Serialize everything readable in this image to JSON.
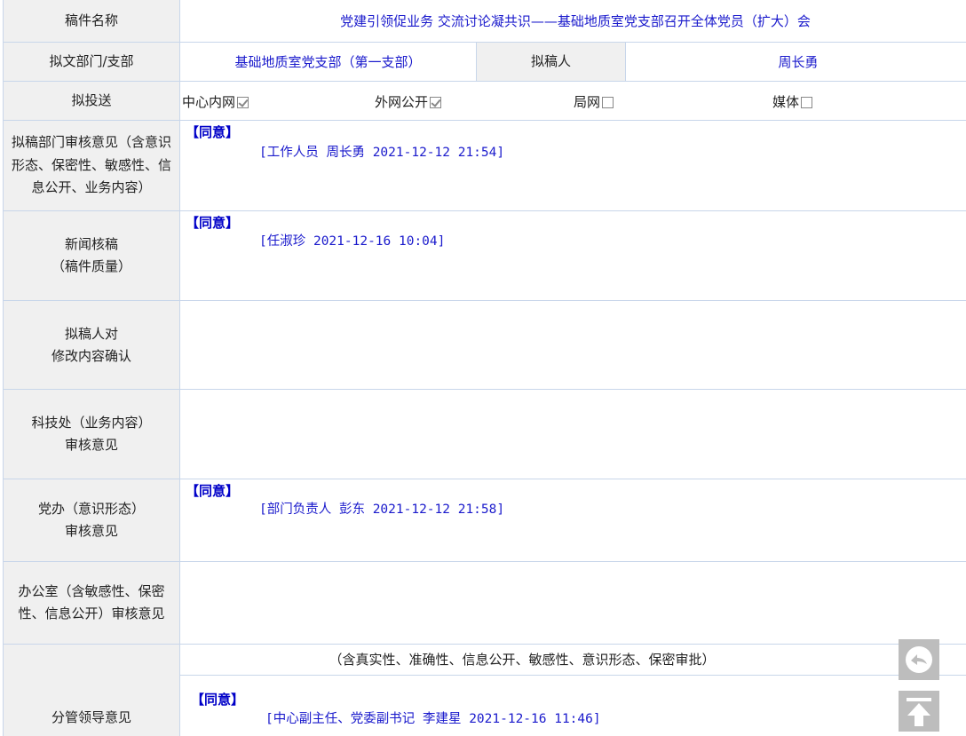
{
  "rows": {
    "title": {
      "label": "稿件名称",
      "value": "党建引领促业务 交流讨论凝共识——基础地质室党支部召开全体党员（扩大）会"
    },
    "dept": {
      "label": "拟文部门/支部",
      "value": "基础地质室党支部（第一支部）",
      "drafter_label": "拟稿人",
      "drafter": "周长勇"
    },
    "send": {
      "label": "拟投送",
      "options": [
        {
          "label": "中心内网",
          "checked": true
        },
        {
          "label": "外网公开",
          "checked": true
        },
        {
          "label": "局网",
          "checked": false
        },
        {
          "label": "媒体",
          "checked": false
        }
      ]
    },
    "dept_review": {
      "label": "拟稿部门审核意见（含意识形态、保密性、敏感性、信息公开、业务内容）",
      "agree": "【同意】",
      "sign": "[工作人员 周长勇 2021-12-12 21:54]"
    },
    "news_review": {
      "label_1": "新闻核稿",
      "label_2": "（稿件质量）",
      "agree": "【同意】",
      "sign": "[任淑珍 2021-12-16 10:04]"
    },
    "drafter_confirm": {
      "label_1": "拟稿人对",
      "label_2": "修改内容确认"
    },
    "tech_review": {
      "label_1": "科技处（业务内容）",
      "label_2": "审核意见"
    },
    "party_review": {
      "label_1": "党办（意识形态）",
      "label_2": "审核意见",
      "agree": "【同意】",
      "sign": "[部门负责人 彭东 2021-12-12 21:58]"
    },
    "office_review": {
      "label_1": "办公室（含敏感性、保密",
      "label_2": "性、信息公开）审核意见"
    },
    "leader_review": {
      "label": "分管领导意见",
      "note": "（含真实性、准确性、信息公开、敏感性、意识形态、保密审批）",
      "agree": "【同意】",
      "sign": "[中心副主任、党委副书记 李建星 2021-12-16 11:46]"
    }
  },
  "buttons": {
    "back_icon": "reply-icon",
    "top_icon": "back-to-top-icon"
  }
}
